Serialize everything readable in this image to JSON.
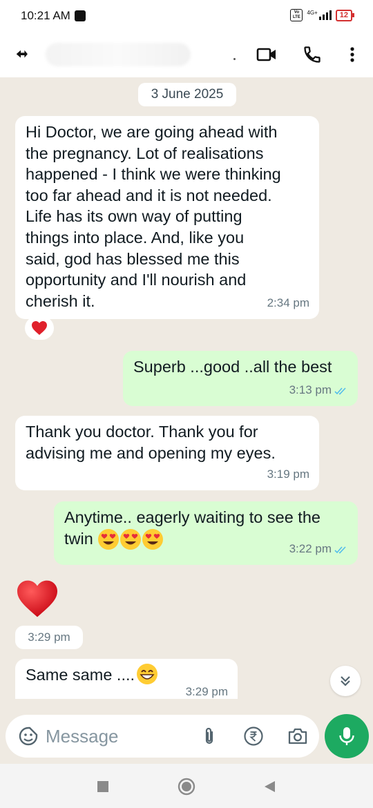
{
  "status_bar": {
    "time": "10:21 AM",
    "network": "4G+",
    "volte": "Vo LTE",
    "battery": "12"
  },
  "header": {
    "contact_name": "",
    "icons": [
      "back-arrow-icon",
      "video-call-icon",
      "voice-call-icon",
      "more-vert-icon"
    ]
  },
  "chat": {
    "date": "3 June 2025",
    "messages": [
      {
        "direction": "incoming",
        "lines": [
          "Hi Doctor, we are going ahead with",
          "the pregnancy. Lot of realisations",
          "happened - I think we were thinking",
          "too far ahead and it is not needed.",
          "Life has its own way of putting",
          "things into place. And, like you",
          "said, god has blessed me this",
          "opportunity and I'll nourish and",
          "cherish it."
        ],
        "time": "2:34 pm",
        "reaction": "red-heart"
      },
      {
        "direction": "outgoing",
        "text": "Superb ...good ..all the best",
        "time": "3:13 pm",
        "status": "read"
      },
      {
        "direction": "incoming",
        "lines": [
          "Thank you doctor. Thank you for",
          "advising me and opening my eyes."
        ],
        "time": "3:19 pm"
      },
      {
        "direction": "outgoing",
        "lines": [
          "Anytime.. eagerly waiting to see the",
          "twin"
        ],
        "emojis": [
          "heart-eyes",
          "heart-eyes",
          "heart-eyes"
        ],
        "time": "3:22 pm",
        "status": "read"
      },
      {
        "direction": "incoming",
        "type": "big-emoji",
        "emoji": "red-heart",
        "time": "3:29 pm"
      },
      {
        "direction": "incoming",
        "text": "Same same ....",
        "emoji": "grinning-smiling-eyes",
        "time": "3:29 pm"
      }
    ]
  },
  "composer": {
    "placeholder": "Message",
    "icons": [
      "sticker-icon",
      "attachment-icon",
      "rupee-payment-icon",
      "camera-icon",
      "mic-icon"
    ]
  },
  "colors": {
    "chat_bg": "#efeae2",
    "outgoing_bubble": "#d9fdd3",
    "accent_green": "#1daa61",
    "read_ticks": "#53bdeb"
  }
}
